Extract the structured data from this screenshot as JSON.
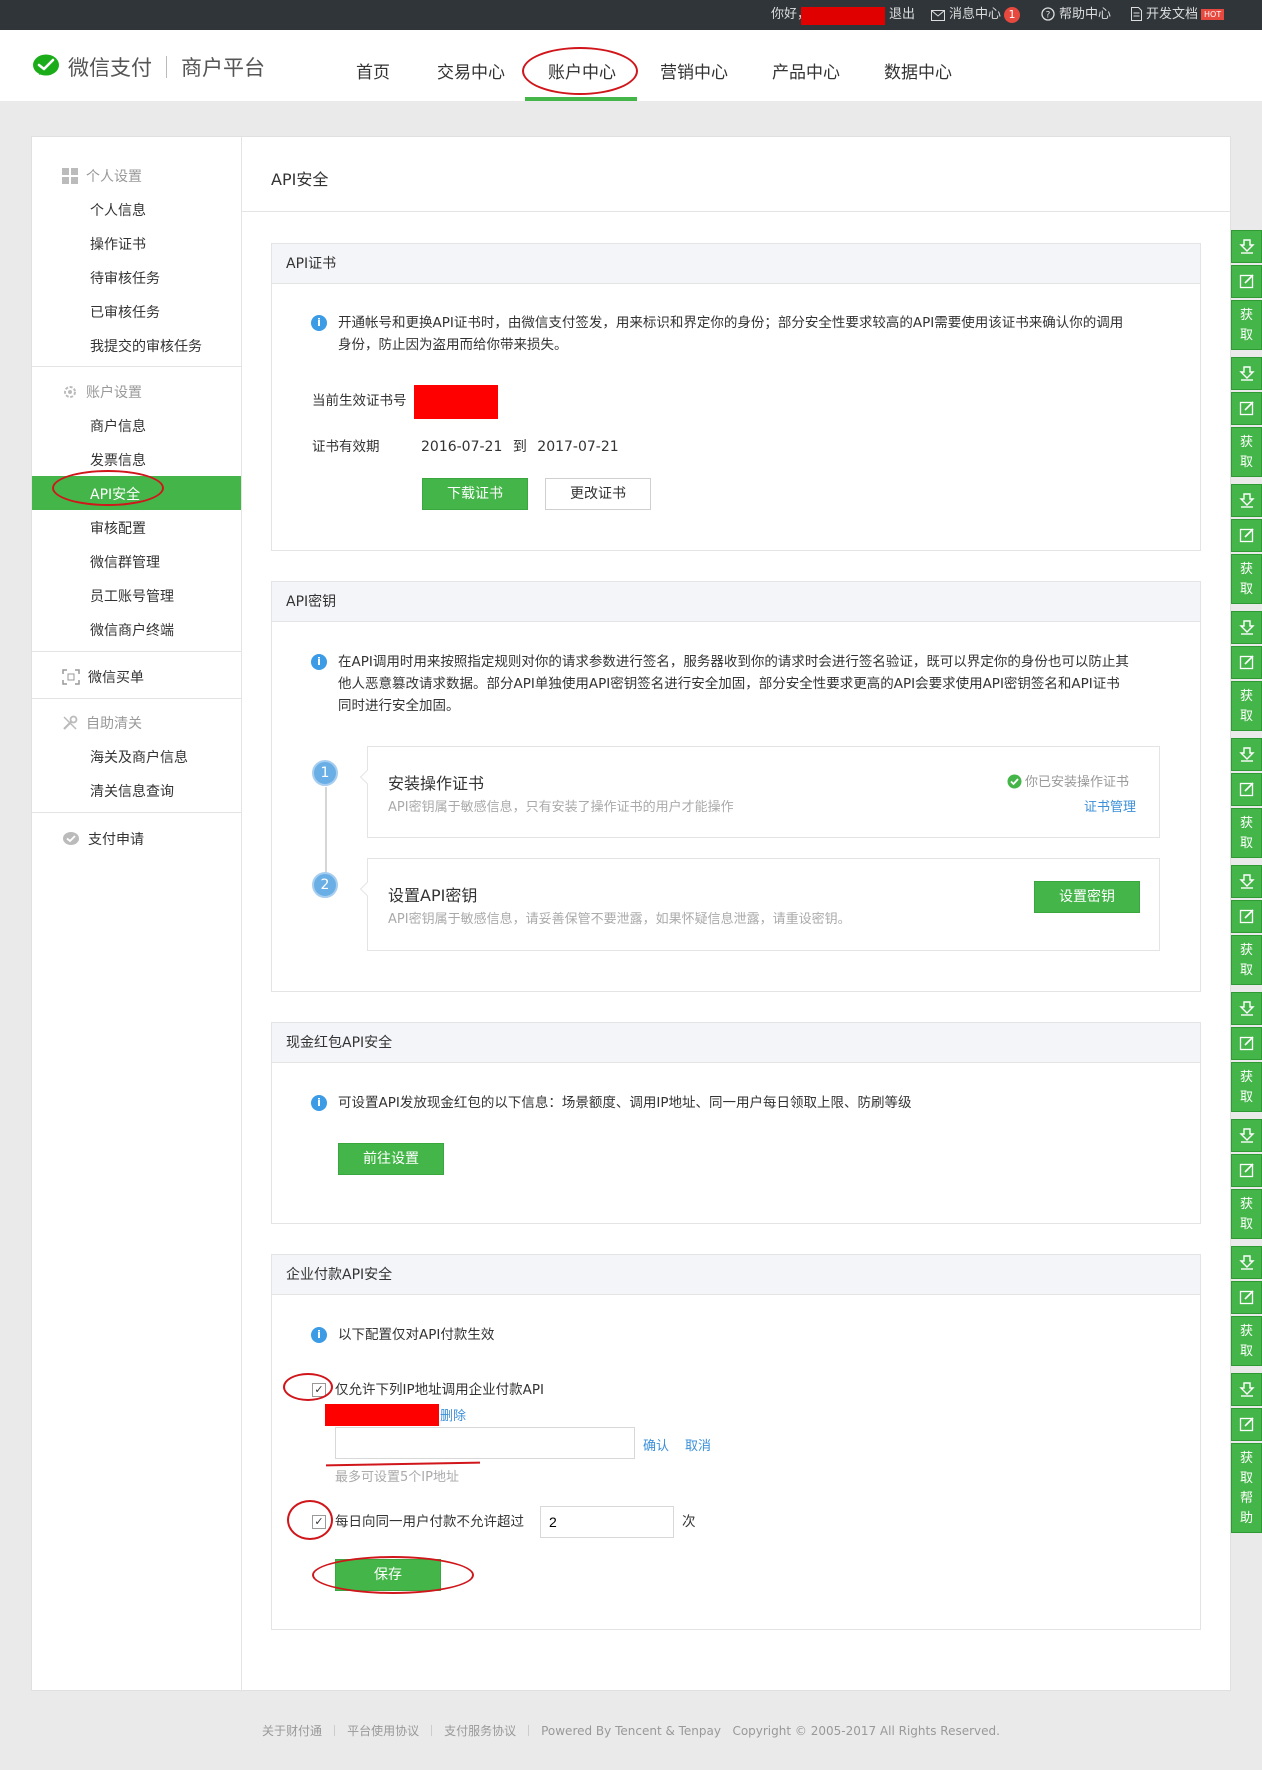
{
  "topbar": {
    "greeting": "你好，",
    "logout": "退出",
    "messages": "消息中心",
    "message_count": "1",
    "help": "帮助中心",
    "docs": "开发文档",
    "docs_badge": "HOT"
  },
  "header": {
    "brand_wechat": "微信支付",
    "brand_platform": "商户平台",
    "nav": [
      "首页",
      "交易中心",
      "账户中心",
      "营销中心",
      "产品中心",
      "数据中心"
    ],
    "active_nav": "账户中心"
  },
  "sidebar": {
    "personal": {
      "title": "个人设置",
      "items": [
        "个人信息",
        "操作证书",
        "待审核任务",
        "已审核任务",
        "我提交的审核任务"
      ]
    },
    "account": {
      "title": "账户设置",
      "items": [
        "商户信息",
        "发票信息",
        "API安全",
        "审核配置",
        "微信群管理",
        "员工账号管理",
        "微信商户终端"
      ]
    },
    "wechat_bill": "微信买单",
    "customs": {
      "title": "自助清关",
      "items": [
        "海关及商户信息",
        "清关信息查询"
      ]
    },
    "payment_apply": "支付申请",
    "active": "API安全"
  },
  "main": {
    "title": "API安全",
    "cert": {
      "title": "API证书",
      "info_line1": "开通帐号和更换API证书时，由微信支付签发，用来标识和界定你的身份；部分安全性要求较高的API需要使用该证书来确认你的调用",
      "info_line2": "身份，防止因为盗用而给你带来损失。",
      "serial_label": "当前生效证书号",
      "validity_label": "证书有效期",
      "validity_from": "2016-07-21",
      "validity_to_word": "到",
      "validity_to": "2017-07-21",
      "download_btn": "下载证书",
      "change_btn": "更改证书"
    },
    "key": {
      "title": "API密钥",
      "info_line1": "在API调用时用来按照指定规则对你的请求参数进行签名，服务器收到你的请求时会进行签名验证，既可以界定你的身份也可以防止其",
      "info_line2": "他人恶意篡改请求数据。部分API单独使用API密钥签名进行安全加固，部分安全性要求更高的API会要求使用API密钥签名和API证书",
      "info_line3": "同时进行安全加固。",
      "step1_num": "1",
      "step1_title": "安装操作证书",
      "step1_desc": "API密钥属于敏感信息，只有安装了操作证书的用户才能操作",
      "step1_status": "你已安装操作证书",
      "step1_link": "证书管理",
      "step2_num": "2",
      "step2_title": "设置API密钥",
      "step2_desc": "API密钥属于敏感信息，请妥善保管不要泄露，如果怀疑信息泄露，请重设密钥。",
      "step2_btn": "设置密钥"
    },
    "redpack": {
      "title": "现金红包API安全",
      "info": "可设置API发放现金红包的以下信息：场景额度、调用IP地址、同一用户每日领取上限、防刷等级",
      "btn": "前往设置"
    },
    "transfer": {
      "title": "企业付款API安全",
      "info": "以下配置仅对API付款生效",
      "ip_check_label": "仅允许下列IP地址调用企业付款API",
      "ip_checked": true,
      "delete_link": "删除",
      "ip_input_value": "",
      "confirm": "确认",
      "cancel": "取消",
      "ip_hint": "最多可设置5个IP地址",
      "daily_check_label": "每日向同一用户付款不允许超过",
      "daily_checked": true,
      "daily_value": "2",
      "daily_unit": "次",
      "save_btn": "保存"
    }
  },
  "right_tools": {
    "get_label": "获取",
    "get_help_label": "获取帮助"
  },
  "footer": {
    "links": [
      "关于财付通",
      "平台使用协议",
      "支付服务协议"
    ],
    "powered": "Powered By Tencent & Tenpay",
    "copyright": "Copyright © 2005-2017 All Rights Reserved."
  },
  "colors": {
    "accent_green": "#44b549",
    "topbar_bg": "#30353a",
    "annotation_red": "#d0161b",
    "redaction": "#ff0000"
  }
}
